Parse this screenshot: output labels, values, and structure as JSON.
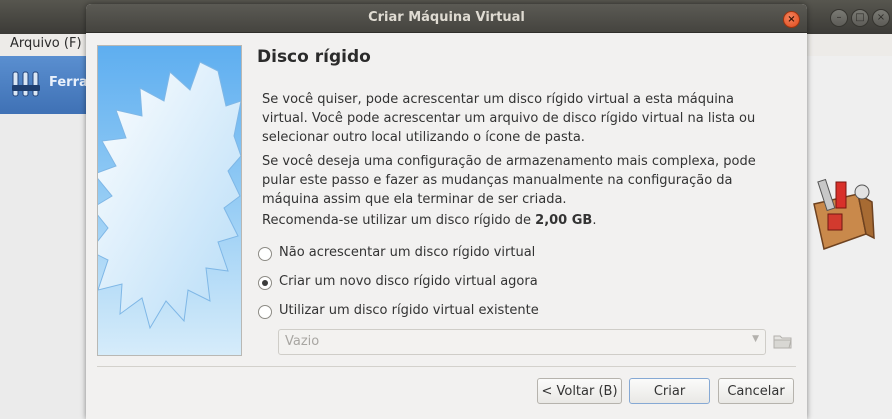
{
  "background_window": {
    "menu": {
      "arquivo_label": "Arquivo (F)"
    },
    "tools_label": "Ferra"
  },
  "dialog": {
    "title": "Criar Máquina Virtual",
    "page_title": "Disco rígido",
    "paragraph_1": "Se você quiser, pode acrescentar um disco rígido virtual a esta máquina virtual. Você pode acrescentar um arquivo de disco rígido virtual na lista ou selecionar outro local utilizando o ícone de pasta.",
    "paragraph_2": "Se você deseja uma configuração de armazenamento mais complexa, pode pular este passo e fazer as mudanças manualmente na configuração da máquina assim que ela terminar de ser criada.",
    "recommend_prefix": "Recomenda-se utilizar um disco rígido de ",
    "recommend_size": "2,00 GB",
    "recommend_suffix": ".",
    "options": [
      {
        "label": "Não acrescentar um disco rígido virtual",
        "checked": false
      },
      {
        "label": "Criar um novo disco rígido virtual agora",
        "checked": true
      },
      {
        "label": "Utilizar um disco rígido virtual existente",
        "checked": false
      }
    ],
    "existing_disk_combo": {
      "value": "Vazio",
      "enabled": false
    },
    "buttons": {
      "back": "< Voltar (B)",
      "create": "Criar",
      "cancel": "Cancelar"
    }
  },
  "colors": {
    "titlebar": "#4a4944",
    "close_button": "#e9541f",
    "side_image_top": "#5eaef0",
    "side_image_bottom": "#d6ecfa",
    "tools_bg": "#4a80c4"
  }
}
